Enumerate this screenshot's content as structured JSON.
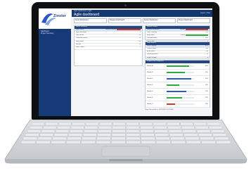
{
  "app": {
    "logo_text": "Zinster",
    "page_title": "Agile dashboard",
    "breadcrumb": "Agile Dashboard » Agile",
    "header_right": "Logout | Help"
  },
  "sidebar": {
    "items": [
      {
        "label": "Dashboard"
      },
      {
        "label": "Project Summary"
      }
    ]
  },
  "tabs": [
    {
      "label": "Sprint Dashboard"
    },
    {
      "label": "Release Dashboard"
    },
    {
      "label": "Defect Dashboard"
    },
    {
      "label": "Project Dashboard"
    }
  ],
  "left_panel": {
    "title": "Sprint Summary",
    "rows": [
      {
        "label": "Sprint Status",
        "value": "Behind Schedule",
        "status": "red"
      },
      {
        "label": "Days Remaining",
        "value": "5",
        "status": ""
      },
      {
        "label": "Total Stories",
        "value": "42",
        "status": ""
      },
      {
        "label": "Completed Stories",
        "value": "28",
        "status": ""
      },
      {
        "label": "Story Points",
        "value": "156",
        "status": ""
      },
      {
        "label": "Velocity",
        "value": "34",
        "status": ""
      },
      {
        "label": "Open Defects",
        "value": "7",
        "status": ""
      }
    ]
  },
  "right_panel_top": {
    "title": "Release Status",
    "rows": [
      {
        "label": "Release Readiness",
        "value": "Medium",
        "status": "red"
      },
      {
        "label": "Code Coverage",
        "value": "72%",
        "status": ""
      },
      {
        "label": "Build Status",
        "value": "Passed",
        "status": "green"
      },
      {
        "label": "Test Automation",
        "value": "64%",
        "status": ""
      },
      {
        "label": "Open Risks",
        "value": "3",
        "status": ""
      }
    ]
  },
  "right_panel_mid": {
    "title": "Team Metrics",
    "rows": [
      {
        "label": "Team Capacity",
        "value": "85%"
      },
      {
        "label": "Planned Hours",
        "value": "640"
      },
      {
        "label": "Actual Hours",
        "value": "598"
      },
      {
        "label": "Remaining Hours",
        "value": "42"
      },
      {
        "label": "Scope Change",
        "value": "4"
      },
      {
        "label": "Blocked Items",
        "value": "2"
      }
    ]
  },
  "right_panel_bottom": {
    "title": "Progress by Component",
    "rows": [
      {
        "label": "Module A",
        "value": "80%",
        "progress": 0.8,
        "color": "#2eaa3f"
      },
      {
        "label": "Module B",
        "value": "65%",
        "progress": 0.65,
        "color": "#2eaa3f"
      },
      {
        "label": "Module C",
        "value": "90%",
        "progress": 0.9,
        "color": "#2a56c6"
      },
      {
        "label": "Module D",
        "value": "45%",
        "progress": 0.45,
        "color": "#2eaa3f"
      },
      {
        "label": "Module E",
        "value": "70%",
        "progress": 0.7,
        "color": "#2a56c6"
      },
      {
        "label": "Module F",
        "value": "55%",
        "progress": 0.55,
        "color": "#2eaa3f"
      },
      {
        "label": "Module G",
        "value": "30%",
        "progress": 0.3,
        "color": "#d23a2d"
      }
    ]
  },
  "footer": "Page Generated on 12/11/2014 10:24 AM",
  "colors": {
    "accent": "#14386f",
    "nav": "#163a78"
  }
}
